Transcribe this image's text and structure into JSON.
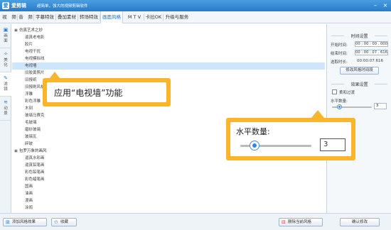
{
  "titlebar": {
    "logo": "爱",
    "app_name": "爱剪辑",
    "slogan": "超简单，强大的视频剪辑软件",
    "minimize": "–",
    "close": "×"
  },
  "tabs": [
    "视　频",
    "音　频",
    "字幕特效",
    "叠加素材",
    "转场特效",
    "画面风格",
    "M T V",
    "卡拉OK",
    "升级与服务"
  ],
  "active_tab": "画面风格",
  "side_tabs": [
    {
      "label": "画面",
      "icon": "picture-icon"
    },
    {
      "label": "美化",
      "icon": "wand-icon"
    },
    {
      "label": "滤镜",
      "icon": "brush-icon"
    },
    {
      "label": "动景",
      "icon": "motion-icon"
    }
  ],
  "tree": {
    "group1": "仿真艺术之妙",
    "group1_items": [
      "逼真老电影",
      "胶片",
      "电视干扰",
      "电视模拟线",
      "电视墙",
      "旧胶黄照片",
      "旧报纸",
      "旧报刷风格",
      "浮雕",
      "彩色浮雕",
      "木刻",
      "玻璃马赛克",
      "毛玻璃",
      "磨砂玻璃",
      "玻璃瓦",
      "碎玻"
    ],
    "selected": "电视墙",
    "group2": "包罗万象的画风",
    "group2_items": [
      "逼真水彩画",
      "逼真铅笔画",
      "彩色铅笔画",
      "彩色蜡笔画",
      "国画",
      "油画",
      "漫画",
      "涂鸦"
    ]
  },
  "right_panel": {
    "time_section": "时间设置",
    "start_label": "开始时间:",
    "start_value": "00 : 00 : 00 . 000",
    "end_label": "结束时间:",
    "end_value": "00 : 00 : 07 . 616",
    "duration_label": "选取时长:",
    "duration_value": "00:00:07.616",
    "modify_time_btn": "修改风格时间段",
    "effect_section": "效果设置",
    "soft_transition": "柔和过渡",
    "hcount_label": "水平数量:",
    "hcount_value": "3"
  },
  "bottom": {
    "add_style": "添加风格效果",
    "favorite": "收藏",
    "delete_style": "删除当前风格",
    "confirm": "确认修改"
  },
  "callout1": {
    "text": "应用“电视墙”功能"
  },
  "callout2": {
    "label": "水平数量:",
    "value": "3",
    "level": 0.2
  },
  "colors": {
    "accent": "#2a7bc8",
    "callout": "#fbb52a",
    "selected_row": "#cfe5f9"
  }
}
